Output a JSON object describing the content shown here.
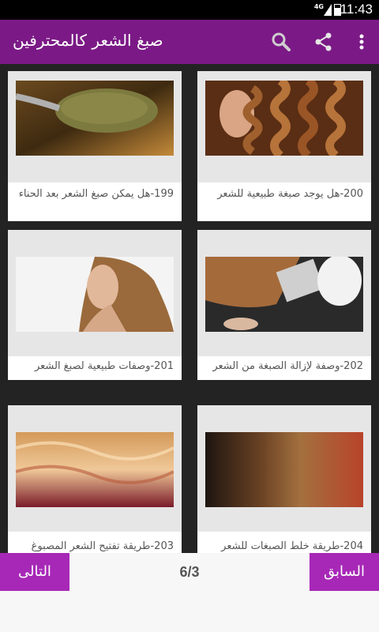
{
  "status": {
    "network": "4G",
    "time": "11:43"
  },
  "appbar": {
    "title": "صبغ الشعر كالمحترفين",
    "icons": [
      "overflow-menu-icon",
      "share-icon",
      "search-icon"
    ]
  },
  "items": [
    {
      "caption": "199-هل يمكن صبغ الشعر بعد الحناء",
      "image": "henna-spoon-photo"
    },
    {
      "caption": "200-هل يوجد صبغة طبيعية للشعر",
      "image": "curly-brown-hair-photo"
    },
    {
      "caption": "201-وصفات طبيعية لصبغ الشعر",
      "image": "woman-long-hair-photo"
    },
    {
      "caption": "202-وصفة لإزالة الصبغة من الشعر",
      "image": "hair-dye-brush-photo"
    },
    {
      "caption": "203-طريقة تفتيح الشعر المصبوغ",
      "image": "blond-red-hair-waves-photo"
    },
    {
      "caption": "204-طريقة خلط الصبغات للشعر",
      "image": "hair-color-swatches-photo"
    }
  ],
  "pagination": {
    "next_label": "التالى",
    "prev_label": "السابق",
    "page_indicator": "6/3"
  },
  "colors": {
    "appbar": "#7b1a86",
    "buttons": "#a728b7",
    "grid_bg": "#232323"
  }
}
